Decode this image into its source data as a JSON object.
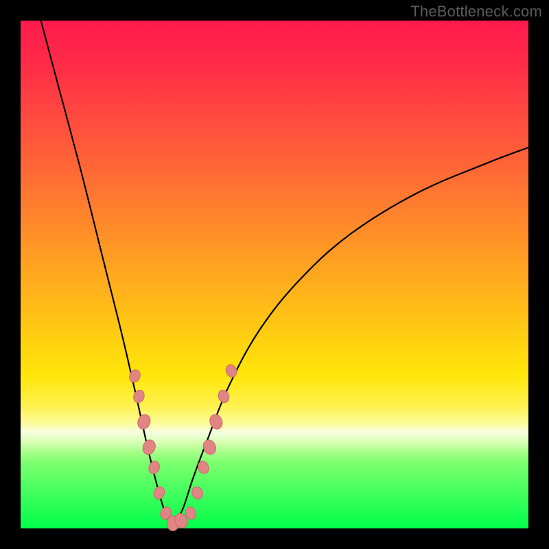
{
  "watermark": "TheBottleneck.com",
  "colors": {
    "frame": "#000000",
    "gradient_top": "#ff1a4d",
    "gradient_mid": "#ffd40f",
    "gradient_bottom": "#00ff4a",
    "curve": "#000000",
    "bead_fill": "#e08484",
    "bead_stroke": "#c96a6a"
  },
  "chart_data": {
    "type": "line",
    "title": "",
    "xlabel": "",
    "ylabel": "",
    "xlim": [
      0,
      100
    ],
    "ylim": [
      0,
      100
    ],
    "note": "V-shaped bottleneck curve; y ≈ 100 at x≈0, minimum y ≈ 0 near x≈30, rising to y ≈ 75 at x≈100. Axes unlabeled; values are positional estimates in percent of plot area.",
    "series": [
      {
        "name": "left-branch",
        "x": [
          4,
          8,
          12,
          16,
          20,
          23,
          25,
          27,
          28.5,
          30
        ],
        "y": [
          100,
          85,
          70,
          54,
          38,
          25,
          16,
          8,
          3,
          0
        ]
      },
      {
        "name": "right-branch",
        "x": [
          30,
          32,
          34,
          37,
          41,
          47,
          55,
          65,
          78,
          92,
          100
        ],
        "y": [
          0,
          4,
          10,
          18,
          28,
          39,
          49,
          58,
          66,
          72,
          75
        ]
      }
    ],
    "markers": {
      "name": "beads",
      "note": "Salmon-colored oval markers clustered near the trough on both branches, roughly y ∈ [0, 32].",
      "points": [
        {
          "x": 22.5,
          "y": 30,
          "r": 6
        },
        {
          "x": 23.3,
          "y": 26,
          "r": 6
        },
        {
          "x": 24.3,
          "y": 21,
          "r": 7
        },
        {
          "x": 25.3,
          "y": 16,
          "r": 7
        },
        {
          "x": 26.3,
          "y": 12,
          "r": 6
        },
        {
          "x": 27.3,
          "y": 7,
          "r": 6
        },
        {
          "x": 28.6,
          "y": 3,
          "r": 6
        },
        {
          "x": 30.0,
          "y": 1,
          "r": 7
        },
        {
          "x": 31.6,
          "y": 1.5,
          "r": 7
        },
        {
          "x": 33.5,
          "y": 3,
          "r": 6
        },
        {
          "x": 34.8,
          "y": 7,
          "r": 6
        },
        {
          "x": 36.0,
          "y": 12,
          "r": 6
        },
        {
          "x": 37.2,
          "y": 16,
          "r": 7
        },
        {
          "x": 38.5,
          "y": 21,
          "r": 7
        },
        {
          "x": 40.0,
          "y": 26,
          "r": 6
        },
        {
          "x": 41.5,
          "y": 31,
          "r": 6
        }
      ]
    }
  }
}
